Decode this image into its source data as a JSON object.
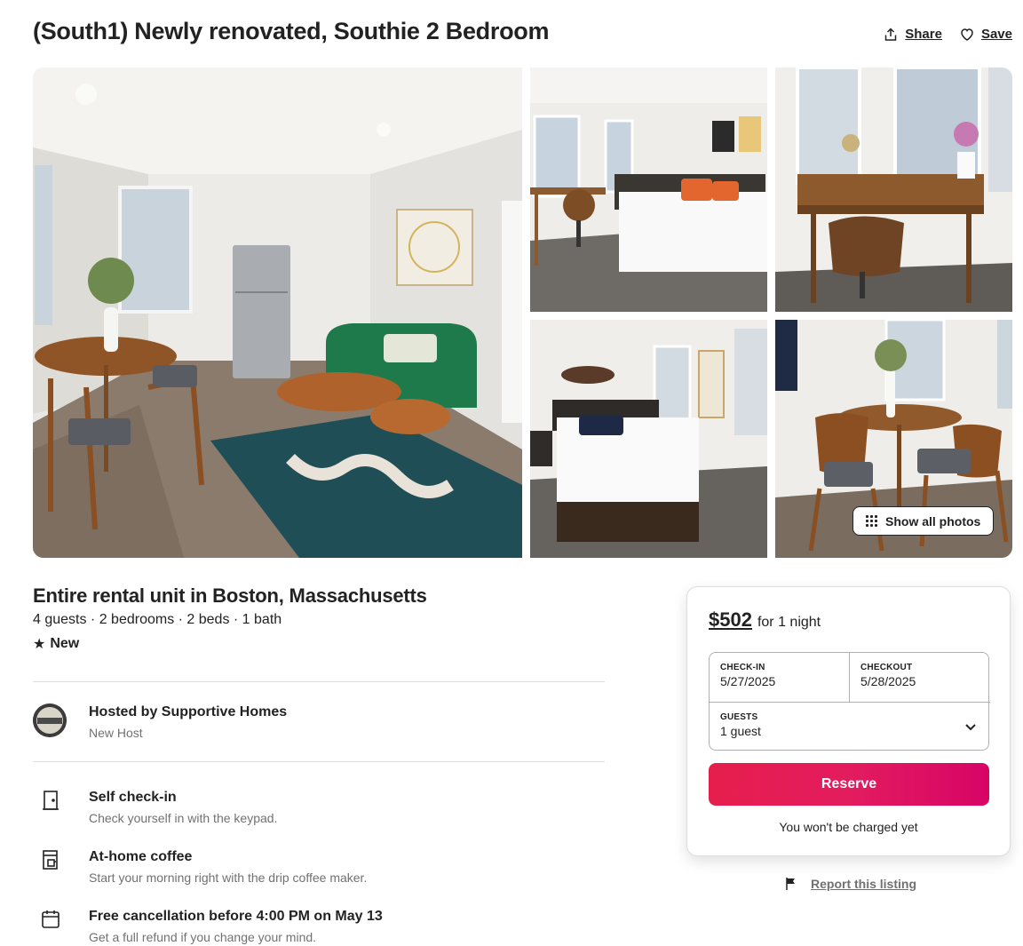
{
  "listing": {
    "title": "(South1) Newly renovated, Southie 2 Bedroom",
    "share_label": "Share",
    "save_label": "Save",
    "show_all_photos_label": "Show all photos",
    "subtitle": "Entire rental unit in Boston, Massachusetts",
    "specs": "4 guests · 2 bedrooms · 2 beds · 1 bath",
    "rating_label": "New"
  },
  "host": {
    "name": "Hosted by Supportive Homes",
    "status": "New Host",
    "avatar_text": "BOSTON"
  },
  "features": [
    {
      "icon": "door-icon",
      "title": "Self check-in",
      "description": "Check yourself in with the keypad."
    },
    {
      "icon": "coffee-maker-icon",
      "title": "At-home coffee",
      "description": "Start your morning right with the drip coffee maker."
    },
    {
      "icon": "calendar-icon",
      "title": "Free cancellation before 4:00 PM on May 13",
      "description": "Get a full refund if you change your mind."
    }
  ],
  "booking": {
    "price": "$502",
    "price_unit": "for 1 night",
    "checkin_label": "CHECK-IN",
    "checkin_value": "5/27/2025",
    "checkout_label": "CHECKOUT",
    "checkout_value": "5/28/2025",
    "guests_label": "GUESTS",
    "guests_value": "1 guest",
    "reserve_label": "Reserve",
    "no_charge_note": "You won't be charged yet"
  },
  "report_label": "Report this listing",
  "colors": {
    "brand": "#e31c5f",
    "text": "#222222",
    "muted": "#717171",
    "border": "#dddddd"
  }
}
